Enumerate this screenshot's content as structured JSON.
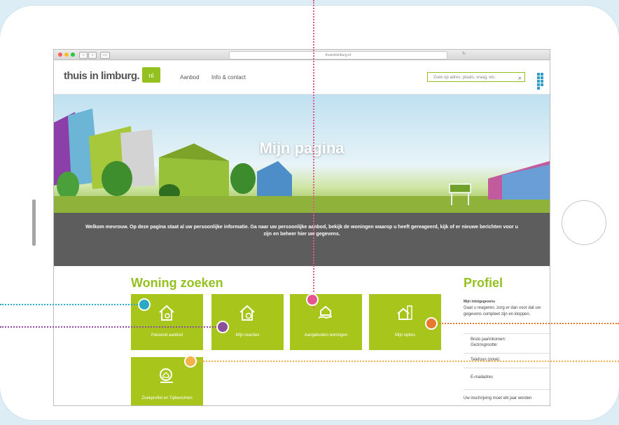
{
  "browser": {
    "url": "thuisinlimburg.nl"
  },
  "site": {
    "logo_text": "thuis in limburg.",
    "logo_suffix": "nl",
    "nav": [
      "Aanbod",
      "Info & contact"
    ],
    "search_placeholder": "Zoek op adres, plaats, vraag, etc."
  },
  "hero": {
    "title": "Mijn pagina"
  },
  "welcome_text": "Welkom mevrouw. Op deze pagina staat al uw persoonlijke informatie. Ga naar uw persoonlijke aanbod, bekijk de woningen waarop u heeft gereageerd, kijk of er nieuwe berichten voor u zijn en beheer hier uw gegevens.",
  "woning": {
    "title": "Woning zoeken",
    "tiles": [
      "Passend aanbod",
      "Mijn reacties",
      "Aangeboden woningen",
      "Mijn opties",
      "Zoekprofiel en Tipberichten"
    ]
  },
  "profiel": {
    "title": "Profiel",
    "subtitle": "Mijn inlotgegevens",
    "intro": "Gaat u reageren, zorg er dan voor dat uw gegevens compleet zijn en kloppen.",
    "fields": [
      "Bruto jaarinkomen:",
      "Gezinsgrootte:",
      "Telefoon (privé)",
      "E-mailadres"
    ],
    "footer": "Uw inschrijving moet elk jaar worden"
  },
  "colors": {
    "accent": "#94c11f",
    "tile": "#a8c51c",
    "marker_teal": "#2aa9c2",
    "marker_purple": "#8b4f9b",
    "marker_pink": "#e6568e",
    "marker_orange": "#e67a2f",
    "marker_yellow": "#f2b34a"
  }
}
